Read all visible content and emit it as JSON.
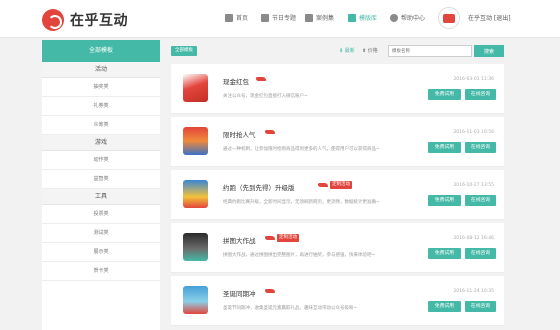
{
  "header": {
    "logo_text": "在乎互动",
    "nav": [
      {
        "label": "首页",
        "icon": "home-icon"
      },
      {
        "label": "节日专题",
        "icon": "calendar-icon"
      },
      {
        "label": "案例集",
        "icon": "grid-icon"
      },
      {
        "label": "模版库",
        "icon": "template-icon",
        "active": true
      },
      {
        "label": "帮助中心",
        "icon": "help-icon"
      }
    ],
    "user_label": "在乎互动 [退出]"
  },
  "sidebar": {
    "header": "全部模板",
    "groups": [
      {
        "title": "活动",
        "items": [
          "抽奖类",
          "礼券类",
          "众筹类"
        ]
      },
      {
        "title": "游戏",
        "items": [
          "动作类",
          "益智类"
        ]
      },
      {
        "title": "工具",
        "items": [
          "投票类",
          "测试类",
          "展示类",
          "贺卡类"
        ]
      }
    ]
  },
  "filters": {
    "all_tag": "全部模板",
    "sort_new": "最新",
    "sort_price": "价格",
    "search_placeholder": "模板名称",
    "search_button": "搜索"
  },
  "colors": {
    "accent": "#44b9a7",
    "hot": "#e2453c"
  },
  "cards": [
    {
      "title": "现金红包",
      "tag": "",
      "desc": "关注公众号，现金红包直接打入微信账户~",
      "date": "2016-03-01 11:36",
      "try": "免费试用",
      "ask": "在线咨询"
    },
    {
      "title": "限时抢人气",
      "tag": "",
      "desc": "通过一种机制，让参加限时抢购商品得到更多的人气，使得用户可以获得商品~",
      "date": "2016-11-03 10:56",
      "try": "免费试用",
      "ask": "在线咨询"
    },
    {
      "title": "约跑（先到先得）升级版",
      "tag": "定制活动",
      "desc": "经典约跑比赛升级，全新时间显示，无须刷新网页，更流畅，数据统计更准确~",
      "date": "2016-10-27 13:55",
      "try": "免费试用",
      "ask": "在线咨询"
    },
    {
      "title": "拼图大作战",
      "tag": "定制活动",
      "desc": "拼图大作战，通过拼图拼出完整图片，再进行抽奖，参与感强，快来体验吧~",
      "date": "2016-08-12 16:46",
      "try": "免费试用",
      "ask": "在线咨询"
    },
    {
      "title": "圣诞同期冲",
      "tag": "",
      "desc": "圣诞节同期冲，收集圣诞元素赢取礼品，趣味互动带动公众号吸粉~",
      "date": "2016-11-24 10:35",
      "try": "免费试用",
      "ask": "在线咨询"
    }
  ]
}
